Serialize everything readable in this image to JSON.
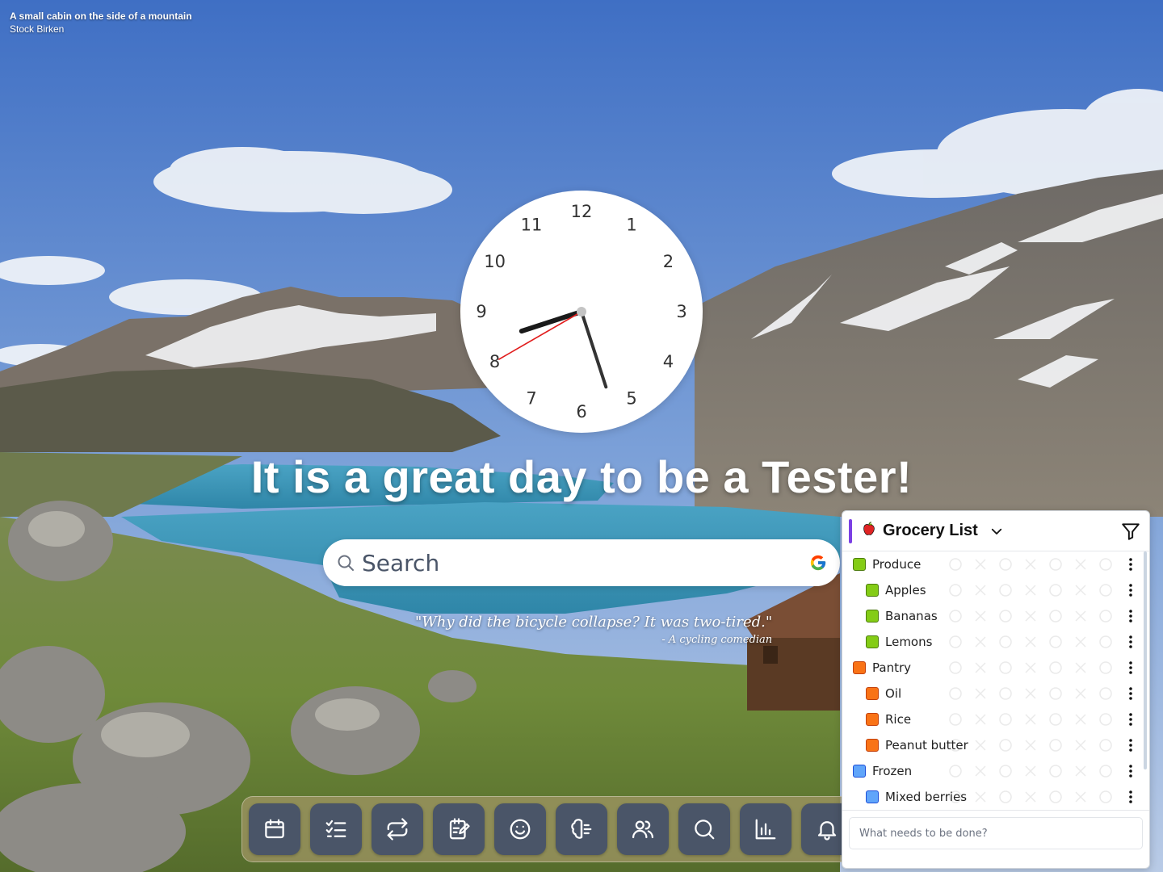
{
  "photo": {
    "title": "A small cabin on the side of a mountain",
    "author": "Stock Birken"
  },
  "clock": {
    "numbers": [
      "12",
      "1",
      "2",
      "3",
      "4",
      "5",
      "6",
      "7",
      "8",
      "9",
      "10",
      "11"
    ],
    "hour": 8.4,
    "minute": 27,
    "second": 40
  },
  "greeting": "It is a great day to be a Tester!",
  "search": {
    "placeholder": "Search",
    "engine_icon": "google-icon"
  },
  "quote": {
    "text": "\"Why did the bicycle collapse? It was two-tired.\"",
    "author": "- A cycling comedian"
  },
  "dock": {
    "buttons": [
      {
        "icon": "calendar-icon"
      },
      {
        "icon": "checklist-icon"
      },
      {
        "icon": "repeat-icon"
      },
      {
        "icon": "notepad-icon"
      },
      {
        "icon": "smiley-icon"
      },
      {
        "icon": "brain-icon"
      },
      {
        "icon": "users-icon"
      },
      {
        "icon": "search-icon"
      },
      {
        "icon": "bar-chart-icon"
      },
      {
        "icon": "bell-icon"
      }
    ]
  },
  "grocery": {
    "title": "Grocery List",
    "title_icon": "apple-icon",
    "accent": "#7b3fe4",
    "items": [
      {
        "label": "Produce",
        "level": 0,
        "color": "#84cc16",
        "border": "#4d7c0f"
      },
      {
        "label": "Apples",
        "level": 1,
        "color": "#84cc16",
        "border": "#4d7c0f"
      },
      {
        "label": "Bananas",
        "level": 1,
        "color": "#84cc16",
        "border": "#4d7c0f"
      },
      {
        "label": "Lemons",
        "level": 1,
        "color": "#84cc16",
        "border": "#4d7c0f"
      },
      {
        "label": "Pantry",
        "level": 0,
        "color": "#f97316",
        "border": "#c2410c"
      },
      {
        "label": "Oil",
        "level": 1,
        "color": "#f97316",
        "border": "#c2410c"
      },
      {
        "label": "Rice",
        "level": 1,
        "color": "#f97316",
        "border": "#c2410c"
      },
      {
        "label": "Peanut butter",
        "level": 1,
        "color": "#f97316",
        "border": "#c2410c"
      },
      {
        "label": "Frozen",
        "level": 0,
        "color": "#60a5fa",
        "border": "#1d4ed8"
      },
      {
        "label": "Mixed berries",
        "level": 1,
        "color": "#60a5fa",
        "border": "#1d4ed8"
      }
    ],
    "new_task_placeholder": "What needs to be done?"
  }
}
